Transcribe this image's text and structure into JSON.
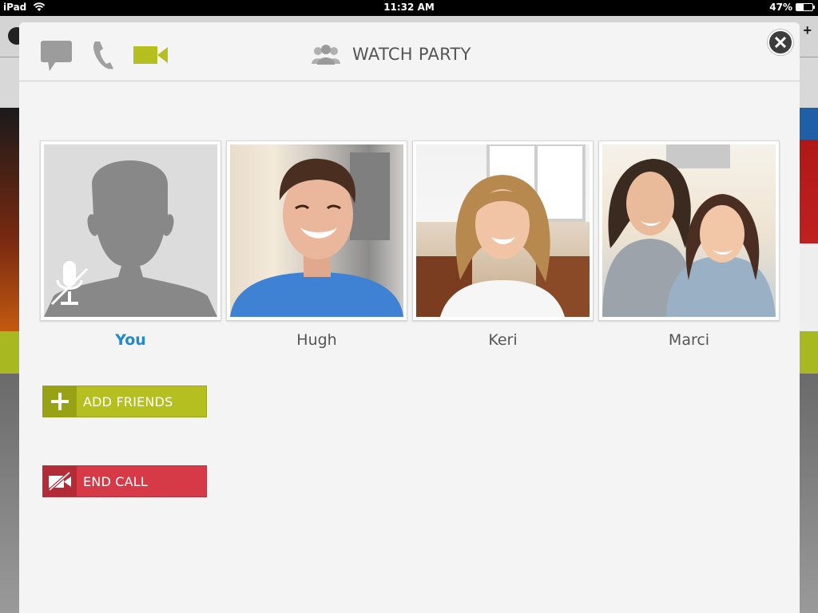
{
  "status_bar": {
    "device": "iPad",
    "time": "11:32 AM",
    "battery": "47%",
    "battery_level": 0.47
  },
  "header": {
    "title": "WATCH PARTY",
    "active_mode": "video",
    "accent": "#b5c020"
  },
  "participants": [
    {
      "name": "You",
      "self": true,
      "muted": true
    },
    {
      "name": "Hugh"
    },
    {
      "name": "Keri"
    },
    {
      "name": "Marci"
    }
  ],
  "actions": {
    "add_friends": "ADD FRIENDS",
    "end_call": "END CALL"
  },
  "colors": {
    "self_name": "#1f8ad1",
    "add_friends": "#b5c020",
    "end_call": "#d63a46"
  },
  "icons": [
    "chat-bubble-icon",
    "phone-icon",
    "video-camera-icon",
    "group-icon",
    "close-icon",
    "muted-microphone-icon",
    "plus-icon",
    "video-off-icon",
    "wifi-icon"
  ]
}
